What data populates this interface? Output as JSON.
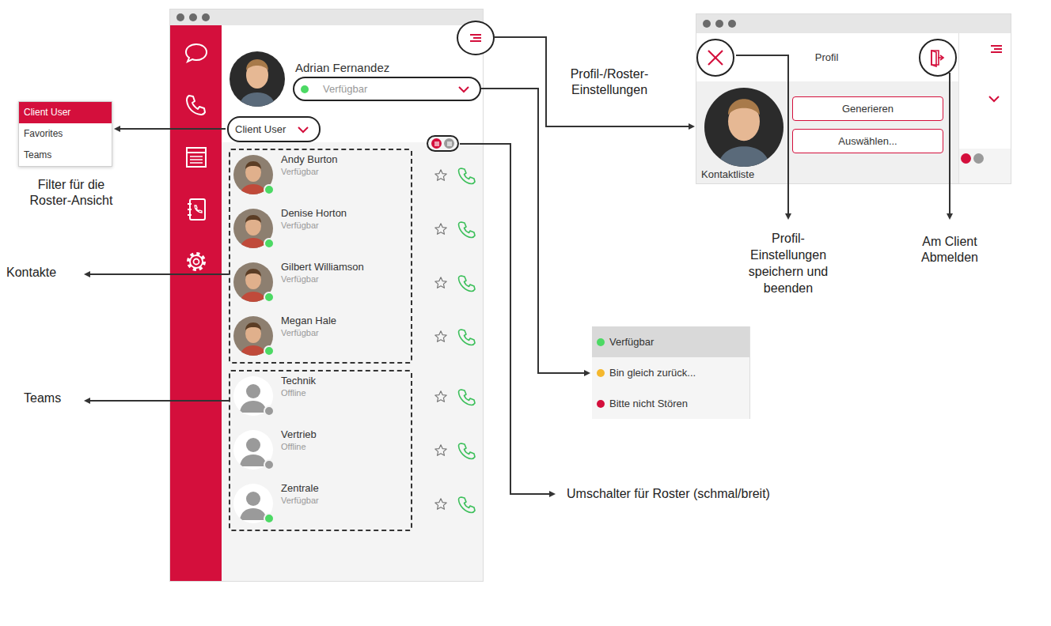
{
  "main_window": {
    "user": {
      "name": "Adrian Fernandez",
      "status": "Verfügbar",
      "online": true
    },
    "filter": "Client User",
    "view_toggle": [
      {
        "selected": true
      },
      {
        "selected": false
      }
    ],
    "contacts": [
      {
        "name": "Andy Burton",
        "status": "Verfügbar",
        "online": true,
        "favorite": false
      },
      {
        "name": "Denise Horton",
        "status": "Verfügbar",
        "online": true,
        "favorite": false
      },
      {
        "name": "Gilbert Williamson",
        "status": "Verfügbar",
        "online": true,
        "favorite": false
      },
      {
        "name": "Megan Hale",
        "status": "Verfügbar",
        "online": true,
        "favorite": false
      }
    ],
    "teams": [
      {
        "name": "Technik",
        "status": "Offline",
        "online": false,
        "favorite": false
      },
      {
        "name": "Vertrieb",
        "status": "Offline",
        "online": false,
        "favorite": false
      },
      {
        "name": "Zentrale",
        "status": "Verfügbar",
        "online": true,
        "favorite": false
      }
    ]
  },
  "filter_menu": [
    {
      "label": "Client User",
      "selected": true
    },
    {
      "label": "Favorites",
      "selected": false
    },
    {
      "label": "Teams",
      "selected": false
    }
  ],
  "status_menu": [
    {
      "label": "Verfügbar",
      "color": "#4cd964",
      "selected": true
    },
    {
      "label": "Bin gleich zurück...",
      "color": "#f5b82e",
      "selected": false
    },
    {
      "label": "Bitte nicht Stören",
      "color": "#d40f3c",
      "selected": false
    }
  ],
  "profile_window": {
    "title": "Profil",
    "buttons": [
      "Generieren",
      "Auswählen..."
    ],
    "section": "Kontaktliste"
  },
  "callouts": {
    "filter": [
      "Filter für die",
      "Roster-Ansicht"
    ],
    "contacts": [
      "Kontakte"
    ],
    "teams": [
      "Teams"
    ],
    "settings": [
      "Profil-/Roster-",
      "Einstellungen"
    ],
    "toggle": [
      "Umschalter für Roster (schmal/breit)"
    ],
    "save": [
      "Profil-",
      "Einstellungen",
      "speichern und",
      "beenden"
    ],
    "logout": [
      "Am Client",
      "Abmelden"
    ]
  }
}
